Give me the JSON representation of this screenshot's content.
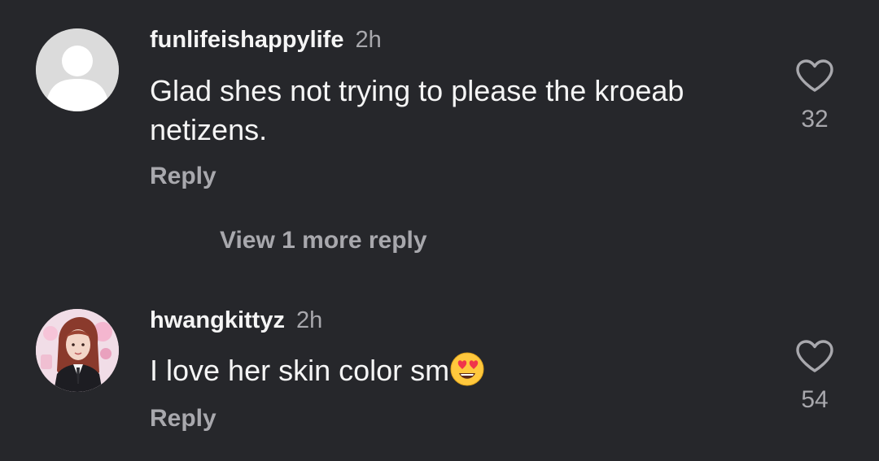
{
  "comments": [
    {
      "username": "funlifeishappylife",
      "time": "2h",
      "text": "Glad shes not trying to please the kroeab netizens.",
      "reply_label": "Reply",
      "likes": "32",
      "avatar": "default-avatar-icon"
    },
    {
      "username": "hwangkittyz",
      "time": "2h",
      "text": "I love her skin color sm",
      "emoji": "heart-eyes-emoji",
      "reply_label": "Reply",
      "likes": "54",
      "avatar": "profile-photo"
    }
  ],
  "view_more_label": "View 1 more reply",
  "colors": {
    "background": "#26272b",
    "primary_text": "#f5f5f5",
    "secondary_text": "#a8a8ad"
  }
}
